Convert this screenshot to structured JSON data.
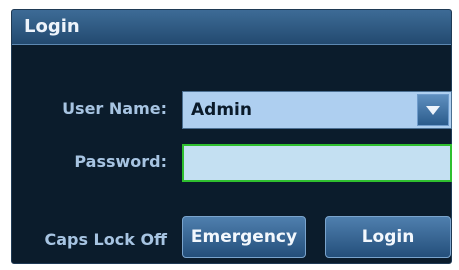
{
  "dialog": {
    "title": "Login"
  },
  "form": {
    "user_name_label": "User Name:",
    "user_name_value": "Admin",
    "password_label": "Password:",
    "password_value": ""
  },
  "status": {
    "caps_lock": "Caps Lock Off"
  },
  "buttons": {
    "emergency": "Emergency",
    "login": "Login"
  },
  "icons": {
    "dropdown": "chevron-down-icon"
  },
  "colors": {
    "background": "#0b1c2c",
    "titlebar": "#234a70",
    "label": "#a7c4e2",
    "combo_bg": "#aecff0",
    "password_border": "#2fbf2f",
    "button": "#2f5e8d"
  }
}
